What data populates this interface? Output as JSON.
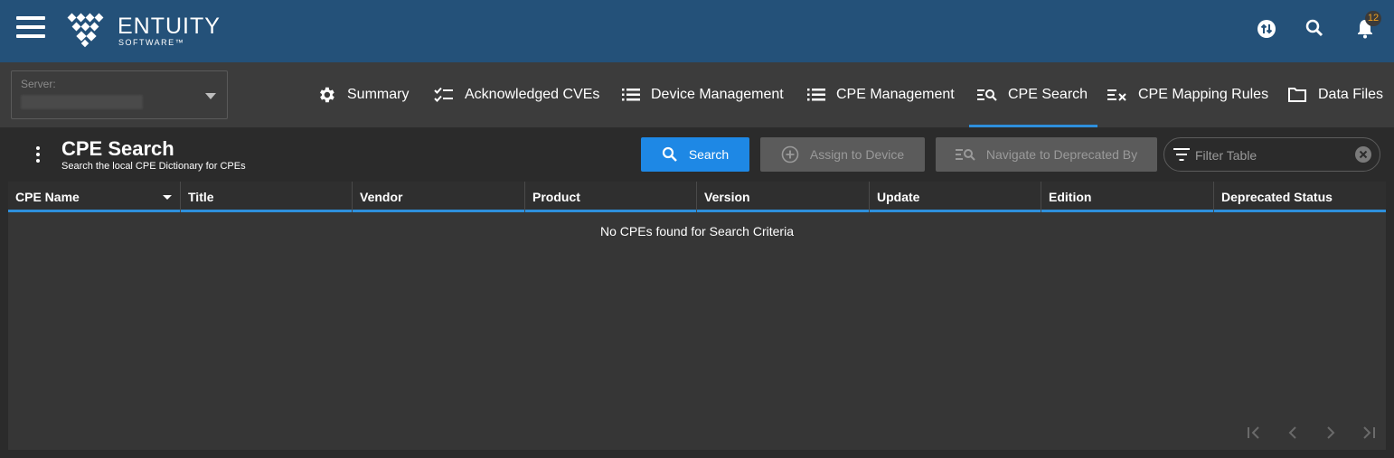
{
  "app": {
    "logo_word": "ENTUITY",
    "logo_sub": "SOFTWARE™",
    "notification_count": "12"
  },
  "icons": {
    "menu": "hamburger-icon",
    "sync": "swap-icon",
    "search": "search-icon",
    "notifications": "bell-icon"
  },
  "server": {
    "label": "Server:",
    "value": ""
  },
  "tabs": [
    {
      "label": "Summary",
      "icon": "gear-icon"
    },
    {
      "label": "Acknowledged CVEs",
      "icon": "checklist-icon"
    },
    {
      "label": "Device Management",
      "icon": "list-icon"
    },
    {
      "label": "CPE Management",
      "icon": "list-icon"
    },
    {
      "label": "CPE Search",
      "icon": "list-search-icon",
      "active": true
    },
    {
      "label": "CPE Mapping Rules",
      "icon": "list-x-icon"
    },
    {
      "label": "Data Files",
      "icon": "folder-icon"
    }
  ],
  "page": {
    "title": "CPE Search",
    "subtitle": "Search the local CPE Dictionary for CPEs"
  },
  "toolbar": {
    "search_label": "Search",
    "assign_label": "Assign to Device",
    "navigate_label": "Navigate to Deprecated By",
    "filter_placeholder": "Filter Table"
  },
  "table": {
    "columns": [
      "CPE Name",
      "Title",
      "Vendor",
      "Product",
      "Version",
      "Update",
      "Edition",
      "Deprecated Status"
    ],
    "sorted_column": "CPE Name",
    "empty_message": "No CPEs found for Search Criteria"
  },
  "colors": {
    "topbar": "#245179",
    "accent": "#1e88e5",
    "badge_text": "#f0a020"
  }
}
